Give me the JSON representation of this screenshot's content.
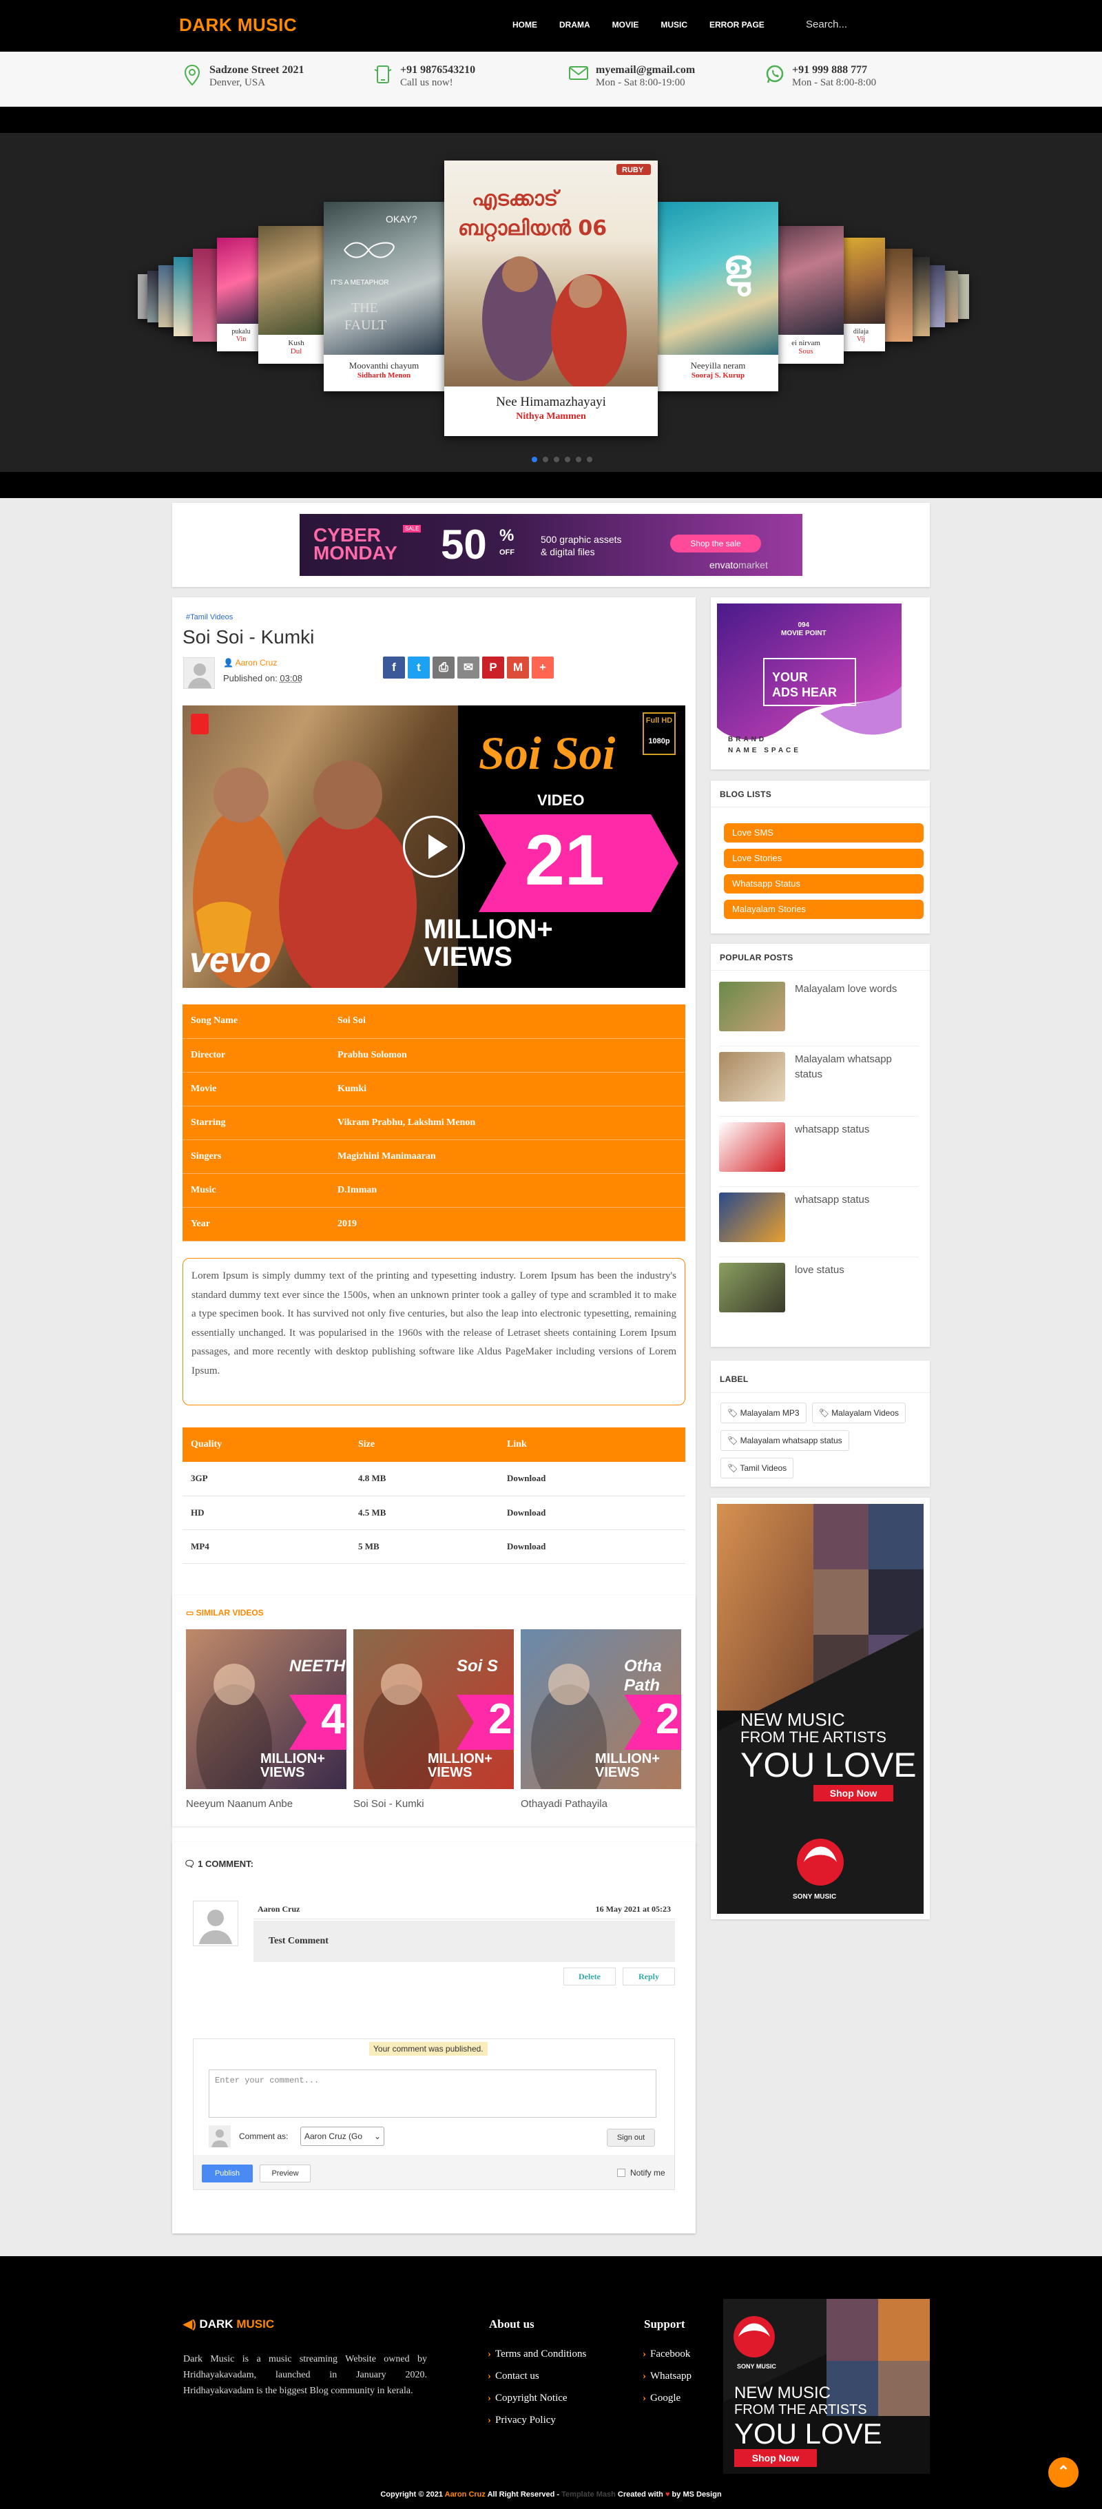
{
  "nav": {
    "logo": "DARK MUSIC",
    "items": [
      "HOME",
      "DRAMA",
      "MOVIE",
      "MUSIC",
      "ERROR PAGE"
    ],
    "search_placeholder": "Search..."
  },
  "contacts": [
    {
      "icon": "location-icon",
      "line1": "Sadzone Street 2021",
      "line2": "Denver, USA"
    },
    {
      "icon": "phone-icon",
      "line1": "+91 9876543210",
      "line2": "Call us now!"
    },
    {
      "icon": "mail-icon",
      "line1": "myemail@gmail.com",
      "line2": "Mon - Sat 8:00-19:00"
    },
    {
      "icon": "whatsapp-icon",
      "line1": "+91 999 888 777",
      "line2": "Mon - Sat 8:00-8:00"
    }
  ],
  "carousel": {
    "center": {
      "title": "Nee Himamazhayayi",
      "artist": "Nithya Mammen",
      "poster_title": "എടക്കാട് ബറ്റാലിയൻ 06",
      "badge": "RUBY"
    },
    "left1": {
      "title": "Moovanthi chayum",
      "artist": "Sidharth Menon"
    },
    "right1": {
      "title": "Neeyilla neram",
      "artist": "Sooraj S. Kurup"
    },
    "left2": {
      "title": "Kush",
      "artist": "Dul"
    },
    "right2": {
      "title": "ei nirvam",
      "artist": "Sous"
    },
    "left3": {
      "title": "pukalu",
      "artist": "Vin"
    },
    "right3": {
      "title": "dilaja",
      "artist": "Vij"
    },
    "dots": [
      "on",
      "",
      "",
      "",
      "",
      ""
    ]
  },
  "banner": {
    "line1": "CYBER",
    "line2": "MONDAY",
    "sale": "SALE",
    "percent": "50",
    "off": "OFF",
    "text1": "500 graphic assets",
    "text2": "& digital files",
    "cta": "Shop the sale",
    "brand": "envato",
    "brand2": "market"
  },
  "post": {
    "category": "#Tamil Videos",
    "title": "Soi Soi - Kumki",
    "author": "Aaron Cruz",
    "published_label": "Published on:",
    "published_time": "03:08",
    "share": [
      {
        "name": "facebook-share",
        "color": "#3b5998",
        "glyph": "f"
      },
      {
        "name": "twitter-share",
        "color": "#1da1f2",
        "glyph": "t"
      },
      {
        "name": "print-share",
        "color": "#777",
        "glyph": "⎙"
      },
      {
        "name": "email-share",
        "color": "#888",
        "glyph": "✉"
      },
      {
        "name": "pinterest-share",
        "color": "#cb2027",
        "glyph": "P"
      },
      {
        "name": "gmail-share",
        "color": "#dd4b39",
        "glyph": "M"
      },
      {
        "name": "more-share",
        "color": "#ff6550",
        "glyph": "+"
      }
    ],
    "video": {
      "song": "Soi Soi",
      "sub": "VIDEO",
      "views_num": "21",
      "views_text1": "MILLION+",
      "views_text2": "VIEWS",
      "brand": "vevo",
      "hd": "Full HD",
      "res": "1080p"
    },
    "info": [
      [
        "Song Name",
        "Soi Soi"
      ],
      [
        "Director",
        "Prabhu Solomon"
      ],
      [
        "Movie",
        "Kumki"
      ],
      [
        "Starring",
        "Vikram Prabhu, Lakshmi Menon"
      ],
      [
        "Singers",
        "Magizhini Manimaaran"
      ],
      [
        "Music",
        "D.Imman"
      ],
      [
        "Year",
        "2019"
      ]
    ],
    "description": "Lorem Ipsum is simply dummy text of the printing and typesetting industry. Lorem Ipsum has been the industry's standard dummy text ever since the 1500s, when an unknown printer took a galley of type and scrambled it to make a type specimen book. It has survived not only five centuries, but also the leap into electronic typesetting, remaining essentially unchanged. It was popularised in the 1960s with the release of Letraset sheets containing Lorem Ipsum passages, and more recently with desktop publishing software like Aldus PageMaker including versions of Lorem Ipsum.",
    "downloads": {
      "headers": [
        "Quality",
        "Size",
        "Link"
      ],
      "rows": [
        [
          "3GP",
          "4.8 MB",
          "Download"
        ],
        [
          "HD",
          "4.5 MB",
          "Download"
        ],
        [
          "MP4",
          "5 MB",
          "Download"
        ]
      ]
    }
  },
  "similar": {
    "heading": "SIMILAR VIDEOS",
    "items": [
      {
        "title": "Neeyum Naanum Anbe",
        "num": "4",
        "label": "NEETH"
      },
      {
        "title": "Soi Soi - Kumki",
        "num": "2",
        "label": "Soi S"
      },
      {
        "title": "Othayadi Pathayila",
        "num": "2",
        "label": "Otha Path"
      }
    ]
  },
  "comments": {
    "heading": "1 COMMENT:",
    "author": "Aaron Cruz",
    "date": "16 May 2021 at 05:23",
    "text": "Test Comment",
    "delete": "Delete",
    "reply": "Reply",
    "published_notice": "Your comment was published.",
    "placeholder": "Enter your comment...",
    "comment_as": "Comment as:",
    "account": "Aaron Cruz (Go",
    "signout": "Sign out",
    "publish": "Publish",
    "preview": "Preview",
    "notify": "Notify me"
  },
  "sidebar": {
    "ad": {
      "brand": "094",
      "brand2": "MOVIE POINT",
      "text1": "YOUR",
      "text2": "ADS HEAR",
      "tag1": "BRAND",
      "tag2": "NAME SPACE"
    },
    "blog_heading": "BLOG LISTS",
    "blog_lists": [
      "Love SMS",
      "Love Stories",
      "Whatsapp Status",
      "Malayalam Stories"
    ],
    "popular_heading": "POPULAR POSTS",
    "popular": [
      {
        "title": "Malayalam love words",
        "c1": "#6a8a4a",
        "c2": "#c9a27a"
      },
      {
        "title": "Malayalam whatsapp status",
        "c1": "#a98a60",
        "c2": "#e8d8c0"
      },
      {
        "title": "whatsapp status",
        "c1": "#ffffff",
        "c2": "#d4252b"
      },
      {
        "title": "whatsapp status",
        "c1": "#2a4a8a",
        "c2": "#e8a030"
      },
      {
        "title": "love status",
        "c1": "#8aa060",
        "c2": "#3a3a2a"
      }
    ],
    "label_heading": "LABEL",
    "labels": [
      "Malayalam MP3",
      "Malayalam Videos",
      "Malayalam whatsapp status",
      "Tamil Videos"
    ],
    "promo": {
      "line1": "NEW MUSIC",
      "line2": "FROM THE ARTISTS",
      "line3": "YOU LOVE",
      "cta": "Shop Now",
      "brand": "SONY MUSIC"
    }
  },
  "footer": {
    "logo1": "DARK",
    "logo2": "MUSIC",
    "about": "Dark Music is a music streaming Website owned by Hridhayakavadam, launched in January 2020. Hridhayakavadam is the biggest Blog community in kerala.",
    "about_heading": "About us",
    "about_links": [
      "Terms and Conditions",
      "Contact us",
      "Copyright Notice",
      "Privacy Policy"
    ],
    "support_heading": "Support",
    "support_links": [
      "Facebook",
      "Whatsapp",
      "Google"
    ],
    "promo": {
      "brand": "SONY MUSIC",
      "line1": "NEW MUSIC",
      "line2": "FROM THE ARTISTS",
      "line3": "YOU LOVE",
      "cta": "Shop Now"
    },
    "copyright1": "Copyright © 2021",
    "copyright_author": "Aaron Cruz",
    "copyright2": "All Right Reserved -",
    "template": "Template Mash",
    "created": "Created with",
    "by": "by MS Design"
  }
}
